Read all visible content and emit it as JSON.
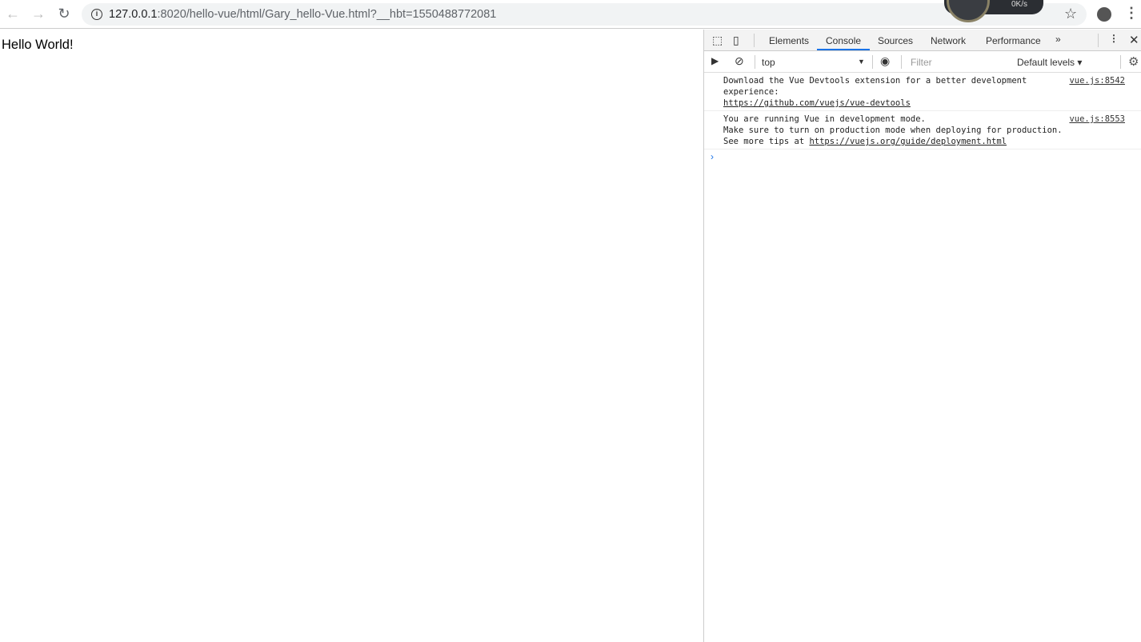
{
  "browser": {
    "url_host": "127.0.0.1",
    "url_rest": ":8020/hello-vue/html/Gary_hello-Vue.html?__hbt=1550488772081",
    "widget_speed": "0K/s"
  },
  "page": {
    "content": "Hello World!"
  },
  "devtools": {
    "tabs": [
      "Elements",
      "Console",
      "Sources",
      "Network",
      "Performance"
    ],
    "active_tab": "Console",
    "context": "top",
    "filter_placeholder": "Filter",
    "levels": "Default levels",
    "messages": [
      {
        "lines": [
          "Download the Vue Devtools extension for a better development",
          "experience:"
        ],
        "link": "https://github.com/vuejs/vue-devtools",
        "source": "vue.js:8542"
      },
      {
        "lines": [
          "You are running Vue in development mode.",
          "Make sure to turn on production mode when deploying for production."
        ],
        "prefix": "See more tips at ",
        "link": "https://vuejs.org/guide/deployment.html",
        "source": "vue.js:8553"
      }
    ]
  }
}
